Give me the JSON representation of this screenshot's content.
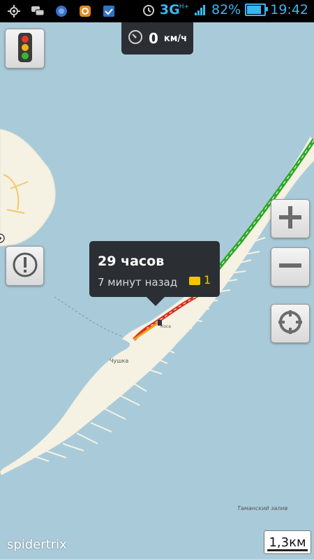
{
  "status_bar": {
    "network": "3G",
    "network_sup": "H+",
    "battery": "82%",
    "time": "19:42",
    "icons": [
      "gps-icon",
      "chat-icon",
      "browser-icon",
      "sync-icon",
      "shield-icon",
      "alarm-icon",
      "signal-icon",
      "battery-icon"
    ],
    "battery_level": 0.82
  },
  "speed": {
    "value": "0",
    "unit": "км/ч"
  },
  "popup": {
    "title": "29 часов",
    "subtitle": "7 минут назад",
    "comments": "1"
  },
  "map_labels": {
    "town": "Чушка",
    "bay": "Таманский залив",
    "station": "Коса"
  },
  "controls": {
    "zoom_in": "+",
    "zoom_out": "−",
    "report": "!"
  },
  "watermark": "spidertrix",
  "scale": "1,3км",
  "colors": {
    "water": "#a9cbd9",
    "land": "#f5f1e3",
    "route_green": "#2ea829",
    "route_red": "#d83020",
    "route_orange": "#f2a31a",
    "accent": "#3bb7ee"
  }
}
